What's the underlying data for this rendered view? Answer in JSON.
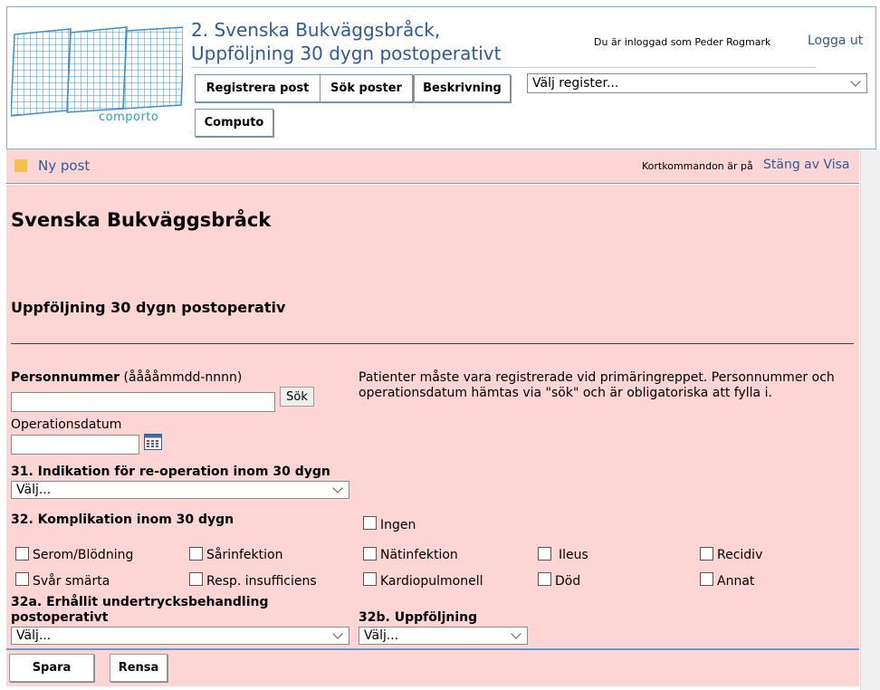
{
  "header": {
    "logo_text": "comporto",
    "title_line1": "2. Svenska Bukväggsbråck,",
    "title_line2": "Uppföljning 30 dygn postoperativt",
    "logged_in_text": "Du är inloggad som Peder Rogmark",
    "logout_label": "Logga ut",
    "nav": {
      "registrera": "Registrera post",
      "sok": "Sök poster",
      "beskrivning": "Beskrivning",
      "computo": "Computo"
    },
    "register_select": "Välj register..."
  },
  "infobar": {
    "new_post": "Ny post",
    "shortcut_label": "Kortkommandon är på",
    "shortcut_toggle": "Stäng av Visa"
  },
  "form": {
    "title": "Svenska Bukväggsbråck",
    "subtitle": "Uppföljning 30 dygn postoperativ",
    "personnummer_label": "Personnummer",
    "personnummer_format": "(ååååmmdd-nnnn)",
    "personnummer_value": "",
    "search_button": "Sök",
    "info_text_line1": "Patienter måste vara registrerade vid primäringreppet. Personnummer och",
    "info_text_line2": "operationsdatum hämtas via \"sök\" och är obligatoriska att fylla i.",
    "operationsdatum_label": "Operationsdatum",
    "operationsdatum_value": "",
    "q31_label": "31. Indikation för re-operation inom 30 dygn",
    "q31_value": "Välj...",
    "q32_label": "32. Komplikation inom 30 dygn",
    "q32_none": "Ingen",
    "complications": {
      "serom": "Serom/Blödning",
      "sarinfektion": "Sårinfektion",
      "natinfektion": "Nätinfektion",
      "ileus": "Ileus",
      "recidiv": "Recidiv",
      "svar_smarta": "Svår smärta",
      "resp": "Resp. insufficiens",
      "kardio": "Kardiopulmonell",
      "dod": "Död",
      "annat": "Annat"
    },
    "q32a_label_line1": "32a. Erhållit undertrycksbehandling",
    "q32a_label_line2": "postoperativt",
    "q32a_value": "Välj...",
    "q32b_label": "32b. Uppföljning",
    "q32b_value": "Välj..."
  },
  "footer": {
    "save": "Spara",
    "clear": "Rensa"
  },
  "colors": {
    "form_bg": "#fdd5d5",
    "link": "#2d5a9a",
    "border_accent": "#5aa0c8"
  }
}
